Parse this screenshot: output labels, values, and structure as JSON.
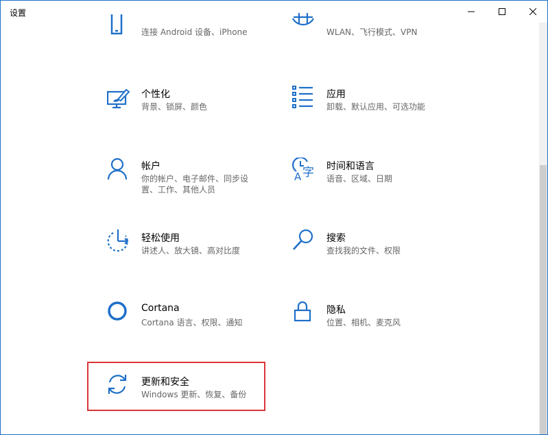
{
  "window": {
    "title": "设置"
  },
  "colors": {
    "accent": "#1e6fc9",
    "highlight": "#d9343a"
  },
  "tiles": [
    {
      "icon": "phone-icon",
      "name": "",
      "desc": "连接 Android 设备、iPhone"
    },
    {
      "icon": "globe-icon",
      "name": "",
      "desc": "WLAN、飞行模式、VPN"
    },
    {
      "icon": "personalization-icon",
      "name": "个性化",
      "desc": "背景、锁屏、颜色"
    },
    {
      "icon": "apps-icon",
      "name": "应用",
      "desc": "卸载、默认应用、可选功能"
    },
    {
      "icon": "person-icon",
      "name": "帐户",
      "desc": "你的帐户、电子邮件、同步设置、工作、其他人员"
    },
    {
      "icon": "time-language-icon",
      "name": "时间和语言",
      "desc": "语音、区域、日期"
    },
    {
      "icon": "ease-of-access-icon",
      "name": "轻松使用",
      "desc": "讲述人、放大镜、高对比度"
    },
    {
      "icon": "search-icon",
      "name": "搜索",
      "desc": "查找我的文件、权限"
    },
    {
      "icon": "cortana-icon",
      "name": "Cortana",
      "desc": "Cortana 语言、权限、通知"
    },
    {
      "icon": "lock-icon",
      "name": "隐私",
      "desc": "位置、相机、麦克风"
    },
    {
      "icon": "update-security-icon",
      "name": "更新和安全",
      "desc": "Windows 更新、恢复、备份"
    }
  ]
}
